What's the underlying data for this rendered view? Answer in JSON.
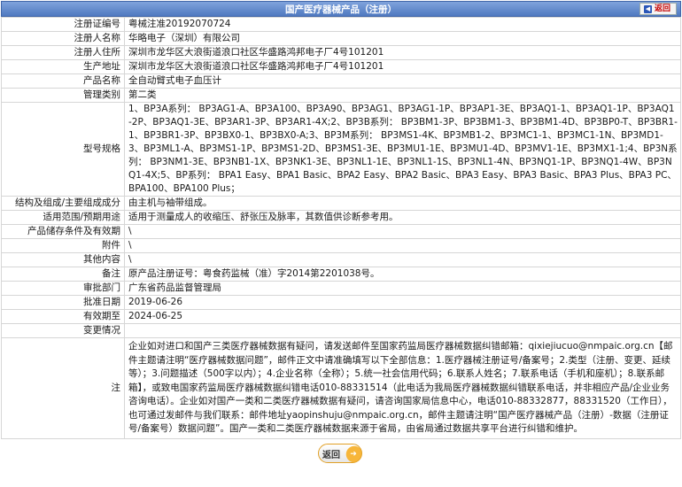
{
  "header": {
    "title": "国产医疗器械产品（注册）",
    "back_label": "返回"
  },
  "rows": [
    {
      "label": "注册证编号",
      "value": "粤械注准20192070724"
    },
    {
      "label": "注册人名称",
      "value": "华略电子（深圳）有限公司"
    },
    {
      "label": "注册人住所",
      "value": "深圳市龙华区大浪街道浪口社区华盛路鸿邦电子厂4号101201"
    },
    {
      "label": "生产地址",
      "value": "深圳市龙华区大浪街道浪口社区华盛路鸿邦电子厂4号101201"
    },
    {
      "label": "产品名称",
      "value": "全自动臂式电子血压计"
    },
    {
      "label": "管理类别",
      "value": "第二类"
    },
    {
      "label": "型号规格",
      "value": "1、BP3A系列： BP3AG1-A、BP3A100、BP3A90、BP3AG1、BP3AG1-1P、BP3AP1-3E、BP3AQ1-1、BP3AQ1-1P、BP3AQ1-2P、BP3AQ1-3E、BP3AR1-3P、BP3AR1-4X;2、BP3B系列： BP3BM1-3P、BP3BM1-3、BP3BM1-4D、BP3BP0-T、BP3BR1-1、BP3BR1-3P、BP3BX0-1、BP3BX0-A;3、BP3M系列： BP3MS1-4K、BP3MB1-2、BP3MC1-1、BP3MC1-1N、BP3MD1-3、BP3ML1-A、BP3MS1-1P、BP3MS1-2D、BP3MS1-3E、BP3MU1-1E、BP3MU1-4D、BP3MV1-1E、BP3MX1-1;4、BP3N系列： BP3NM1-3E、BP3NB1-1X、BP3NK1-3E、BP3NL1-1E、BP3NL1-1S、BP3NL1-4N、BP3NQ1-1P、BP3NQ1-4W、BP3NQ1-4X;5、BP系列： BPA1 Easy、BPA1 Basic、BPA2 Easy、BPA2 Basic、BPA3 Easy、BPA3 Basic、BPA3 Plus、BPA3 PC、BPA100、BPA100 Plus；"
    },
    {
      "label": "结构及组成/主要组成成分",
      "value": "由主机与袖带组成。"
    },
    {
      "label": "适用范围/预期用途",
      "value": "适用于测量成人的收缩压、舒张压及脉率，其数值供诊断参考用。"
    },
    {
      "label": "产品储存条件及有效期",
      "value": "\\"
    },
    {
      "label": "附件",
      "value": "\\"
    },
    {
      "label": "其他内容",
      "value": "\\"
    },
    {
      "label": "备注",
      "value": "原产品注册证号：粤食药监械（准）字2014第2201038号。"
    },
    {
      "label": "审批部门",
      "value": "广东省药品监督管理局"
    },
    {
      "label": "批准日期",
      "value": "2019-06-26"
    },
    {
      "label": "有效期至",
      "value": "2024-06-25"
    },
    {
      "label": "变更情况",
      "value": ""
    }
  ],
  "notes": {
    "label": "注",
    "text": "企业如对进口和国产三类医疗器械数据有疑问，请发送邮件至国家药监局医疗器械数据纠错邮箱：qixiejiucuo@nmpaic.org.cn【邮件主题请注明“医疗器械数据问题”，邮件正文中请准确填写以下全部信息：1.医疗器械注册证号/备案号；2.类型（注册、变更、延续等）；3.问题描述（500字以内）；4.企业名称（全称）；5.统一社会信用代码；6.联系人姓名；7.联系电话（手机和座机）；8.联系邮箱】，或致电国家药监局医疗器械数据纠错电话010-88331514（此电话为我局医疗器械数据纠错联系电话，并非相应产品/企业业务咨询电话）。企业如对国产一类和二类医疗器械数据有疑问，请咨询国家局信息中心，电话010-88332877，88331520（工作日），也可通过发邮件与我们联系：邮件地址yaopinshuju@nmpaic.org.cn，邮件主题请注明“国产医疗器械产品（注册）-数据（注册证号/备案号）数据问题”。国产一类和二类医疗器械数据来源于省局，由省局通过数据共享平台进行纠错和维护。"
  },
  "footer": {
    "back_label": "返回"
  }
}
